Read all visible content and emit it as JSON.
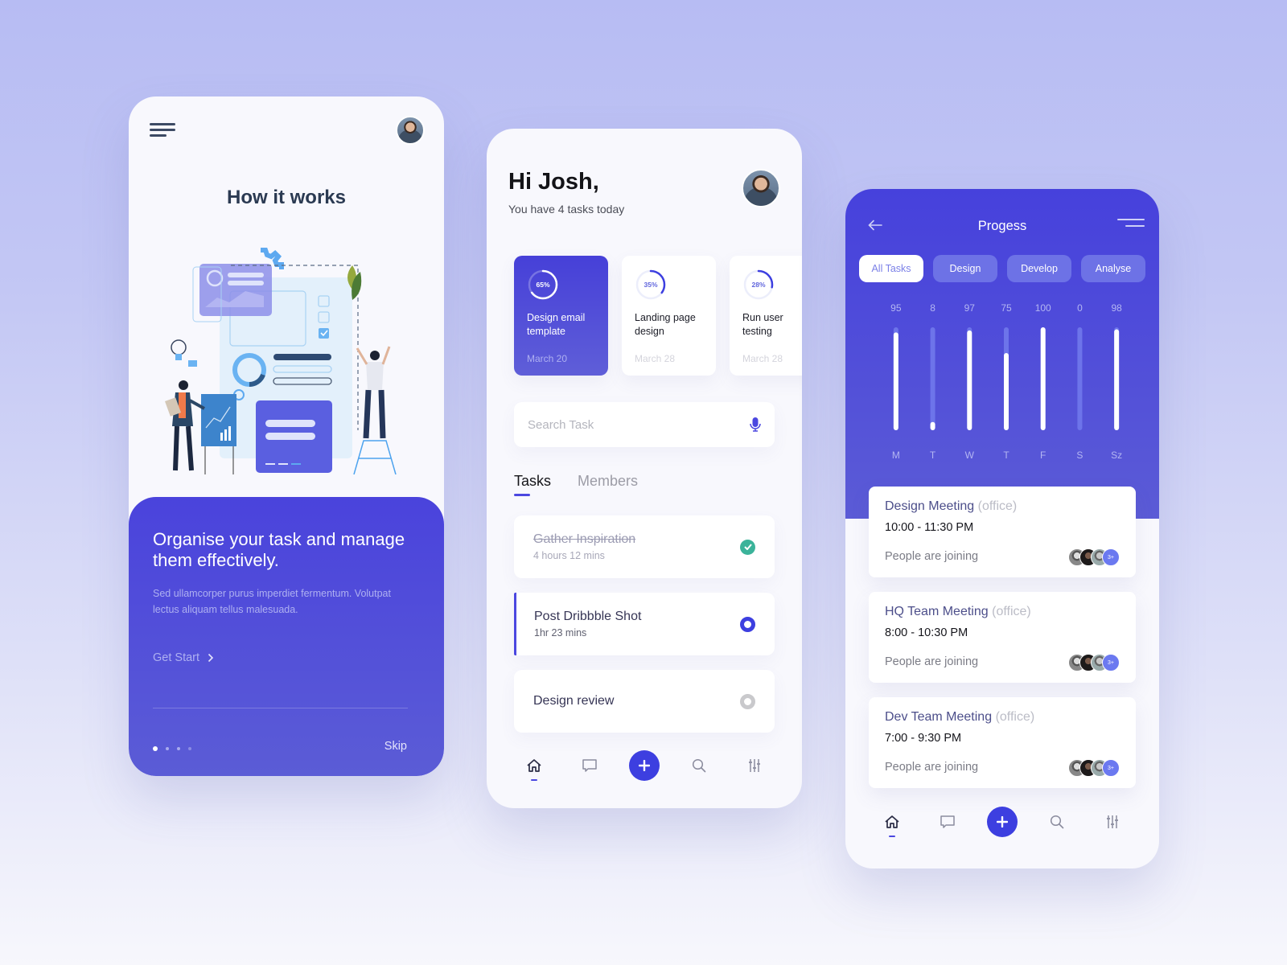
{
  "onboarding": {
    "title": "How it works",
    "headline": "Organise your task and manage them effectively.",
    "body": "Sed ullamcorper purus imperdiet fermentum. Volutpat lectus aliquam tellus malesuada.",
    "get_start_label": "Get Start",
    "skip_label": "Skip",
    "pagination": {
      "total": 4,
      "current": 1
    }
  },
  "home": {
    "greeting": "Hi Josh,",
    "subtitle": "You have 4 tasks today",
    "project_cards": [
      {
        "progress_label": "65%",
        "progress": 0.65,
        "title": "Design email template",
        "date": "March 20",
        "active": true
      },
      {
        "progress_label": "35%",
        "progress": 0.35,
        "title": "Landing page design",
        "date": "March 28",
        "active": false
      },
      {
        "progress_label": "28%",
        "progress": 0.28,
        "title": "Run user testing",
        "date": "March 28",
        "active": false
      }
    ],
    "search": {
      "placeholder": "Search Task",
      "value": ""
    },
    "tabs": [
      {
        "label": "Tasks",
        "active": true
      },
      {
        "label": "Members",
        "active": false
      }
    ],
    "tasks": [
      {
        "name": "Gather Inspiration",
        "duration": "4 hours 12 mins",
        "status": "done"
      },
      {
        "name": "Post Dribbble Shot",
        "duration": "1hr 23 mins",
        "status": "in-progress"
      },
      {
        "name": "Design review",
        "duration": "",
        "status": "pending"
      }
    ]
  },
  "progress": {
    "title": "Progess",
    "filters": [
      {
        "label": "All Tasks",
        "active": true
      },
      {
        "label": "Design",
        "active": false
      },
      {
        "label": "Develop",
        "active": false
      },
      {
        "label": "Analyse",
        "active": false
      }
    ],
    "meetings": [
      {
        "title": "Design Meeting",
        "location": "(office)",
        "time": "10:00 - 11:30 PM",
        "people_label": "People are joining",
        "extra_count": "3+"
      },
      {
        "title": "HQ Team Meeting",
        "location": "(office)",
        "time": "8:00 - 10:30 PM",
        "people_label": "People are joining",
        "extra_count": "3+"
      },
      {
        "title": "Dev Team Meeting",
        "location": "(office)",
        "time": "7:00 - 9:30 PM",
        "people_label": "People are joining",
        "extra_count": "3+"
      }
    ]
  },
  "chart_data": {
    "type": "bar",
    "title": "",
    "categories": [
      "M",
      "T",
      "W",
      "T",
      "F",
      "S",
      "Sz"
    ],
    "values": [
      95,
      8,
      97,
      75,
      100,
      0,
      98
    ],
    "xlabel": "",
    "ylabel": "",
    "ylim": [
      0,
      100
    ],
    "grid": false
  },
  "nav": {
    "items": [
      "home",
      "messages",
      "add",
      "search",
      "settings"
    ]
  },
  "colors": {
    "accent": "#4b47e0",
    "done": "#3bb39a",
    "pending": "#c9c9cc"
  }
}
